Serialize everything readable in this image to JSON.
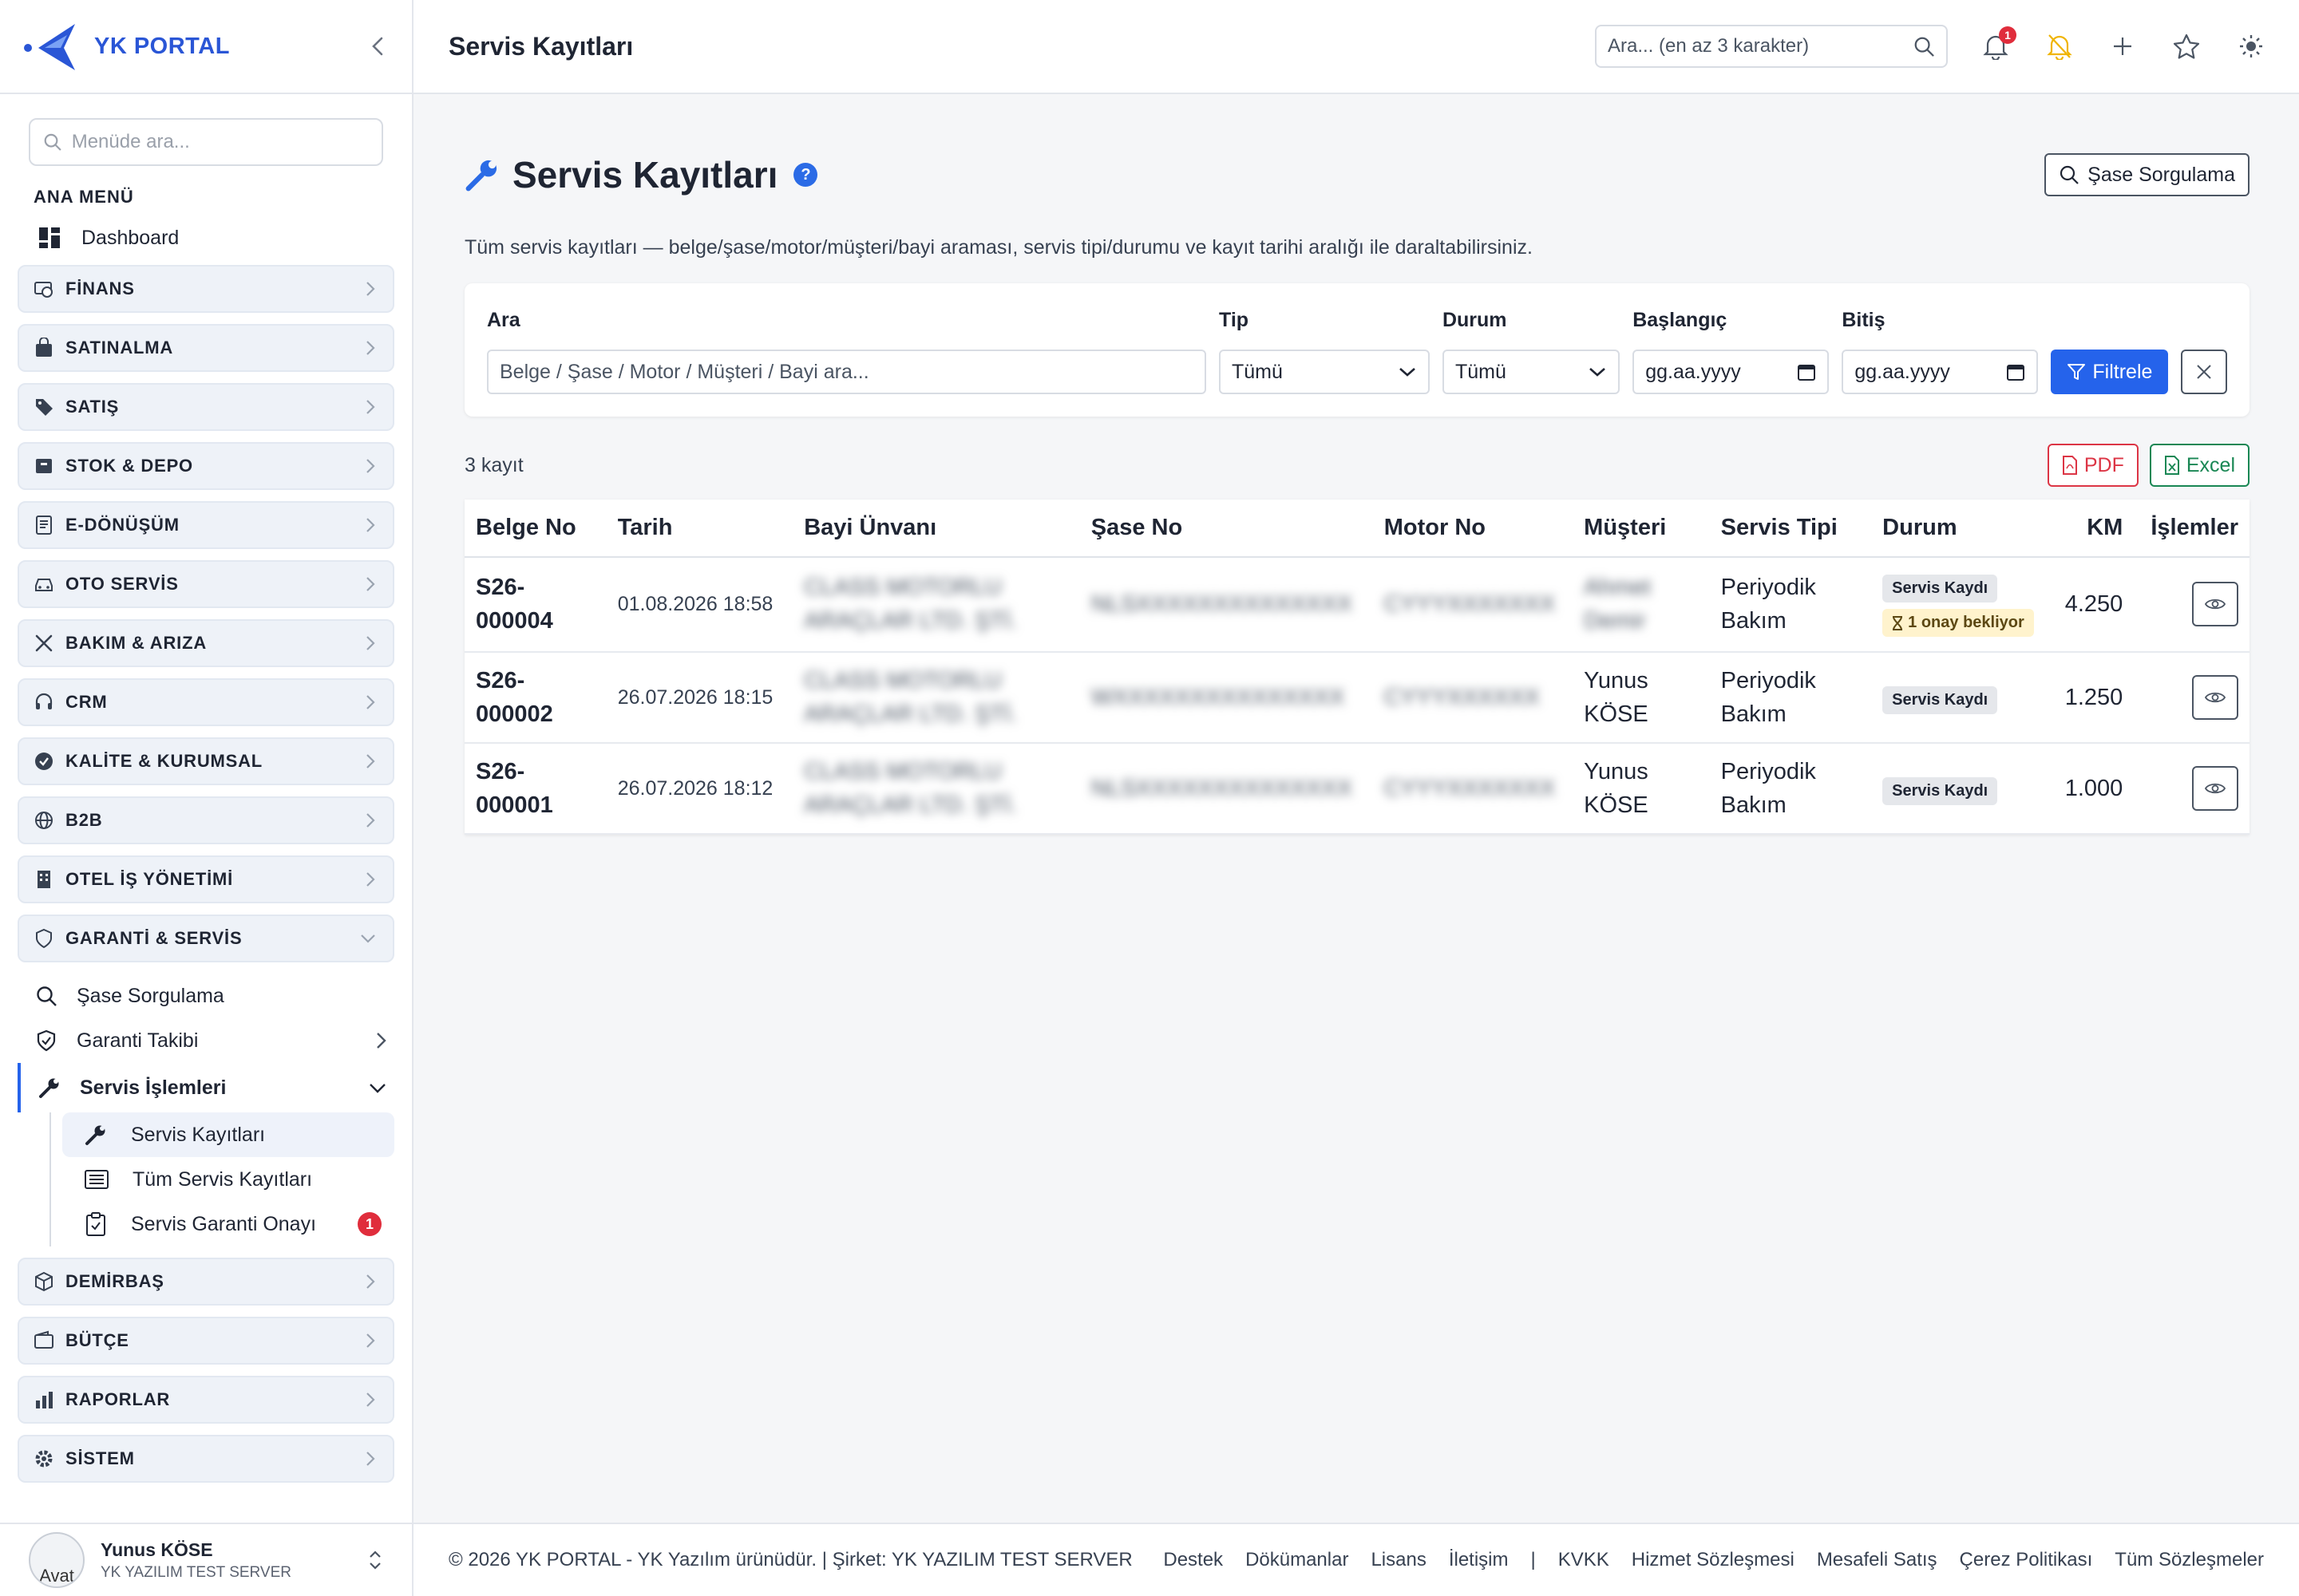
{
  "brand": {
    "name": "YK PORTAL"
  },
  "sidebar": {
    "search_placeholder": "Menüde ara...",
    "menu_title": "ANA MENÜ",
    "dashboard_label": "Dashboard",
    "groups_top": [
      {
        "label": "FİNANS",
        "icon": "finance-icon"
      },
      {
        "label": "SATINALMA",
        "icon": "shopping-bag-icon"
      },
      {
        "label": "SATIŞ",
        "icon": "tag-icon"
      },
      {
        "label": "STOK & DEPO",
        "icon": "box-icon"
      },
      {
        "label": "E-DÖNÜŞÜM",
        "icon": "document-icon"
      },
      {
        "label": "OTO SERVİS",
        "icon": "car-icon"
      },
      {
        "label": "BAKIM & ARIZA",
        "icon": "tools-icon"
      },
      {
        "label": "CRM",
        "icon": "headset-icon"
      },
      {
        "label": "KALİTE & KURUMSAL",
        "icon": "badge-check-icon"
      },
      {
        "label": "B2B",
        "icon": "globe-icon"
      },
      {
        "label": "OTEL İŞ YÖNETİMİ",
        "icon": "building-icon"
      }
    ],
    "open_group": {
      "label": "GARANTİ & SERVİS",
      "items": [
        {
          "label": "Şase Sorgulama"
        },
        {
          "label": "Garanti Takibi"
        }
      ],
      "active_parent": {
        "label": "Servis İşlemleri",
        "children": [
          {
            "label": "Servis Kayıtları"
          },
          {
            "label": "Tüm Servis Kayıtları"
          },
          {
            "label": "Servis Garanti Onayı",
            "badge": "1"
          }
        ]
      }
    },
    "groups_bottom": [
      {
        "label": "DEMİRBAŞ"
      },
      {
        "label": "BÜTÇE"
      },
      {
        "label": "RAPORLAR"
      },
      {
        "label": "SİSTEM"
      }
    ],
    "user": {
      "name": "Yunus KÖSE",
      "org": "YK YAZILIM TEST SERVER",
      "avatar_alt": "Avat"
    }
  },
  "topbar": {
    "title": "Servis Kayıtları",
    "search_placeholder": "Ara... (en az 3 karakter)",
    "notification_count": "1"
  },
  "page": {
    "title": "Servis Kayıtları",
    "help": "?",
    "chassis_btn": "Şase Sorgulama",
    "description": "Tüm servis kayıtları — belge/şase/motor/müşteri/bayi araması, servis tipi/durumu ve kayıt tarihi aralığı ile daraltabilirsiniz."
  },
  "filters": {
    "search_label": "Ara",
    "search_placeholder": "Belge / Şase / Motor / Müşteri / Bayi ara...",
    "type_label": "Tip",
    "type_value": "Tümü",
    "status_label": "Durum",
    "status_value": "Tümü",
    "start_label": "Başlangıç",
    "start_placeholder": "gg.aa.yyyy",
    "end_label": "Bitiş",
    "end_placeholder": "gg.aa.yyyy",
    "filter_btn": "Filtrele"
  },
  "list": {
    "count": "3 kayıt",
    "pdf_btn": "PDF",
    "excel_btn": "Excel",
    "columns": [
      "Belge No",
      "Tarih",
      "Bayi Ünvanı",
      "Şase No",
      "Motor No",
      "Müşteri",
      "Servis Tipi",
      "Durum",
      "KM",
      "İşlemler"
    ],
    "rows": [
      {
        "doc": "S26-000004",
        "date": "01.08.2026 18:58",
        "dealer": "CLASS MOTORLU ARAÇLAR LTD. ŞTİ.",
        "chassis": "NLSXXXXXXXXXXXXXX",
        "engine": "CYYYXXXXXXX",
        "customer": "Ahmet Demir",
        "customer_blurred": true,
        "type": "Periyodik Bakım",
        "status": "Servis Kaydı",
        "pending": "1 onay bekliyor",
        "km": "4.250"
      },
      {
        "doc": "S26-000002",
        "date": "26.07.2026 18:15",
        "dealer": "CLASS MOTORLU ARAÇLAR LTD. ŞTİ.",
        "chassis": "WXXXXXXXXXXXXXXX",
        "engine": "CYYYXXXXXX",
        "customer": "Yunus KÖSE",
        "customer_blurred": false,
        "type": "Periyodik Bakım",
        "status": "Servis Kaydı",
        "pending": "",
        "km": "1.250"
      },
      {
        "doc": "S26-000001",
        "date": "26.07.2026 18:12",
        "dealer": "CLASS MOTORLU ARAÇLAR LTD. ŞTİ.",
        "chassis": "NLSXXXXXXXXXXXXXX",
        "engine": "CYYYXXXXXXX",
        "customer": "Yunus KÖSE",
        "customer_blurred": false,
        "type": "Periyodik Bakım",
        "status": "Servis Kaydı",
        "pending": "",
        "km": "1.000"
      }
    ]
  },
  "footer": {
    "copyright": "© 2026 YK PORTAL - YK Yazılım ürünüdür. | Şirket: YK YAZILIM TEST SERVER",
    "links_left": [
      "Destek",
      "Dökümanlar",
      "Lisans",
      "İletişim"
    ],
    "separator": "|",
    "links_right": [
      "KVKK",
      "Hizmet Sözleşmesi",
      "Mesafeli Satış",
      "Çerez Politikası",
      "Tüm Sözleşmeler"
    ]
  },
  "colors": {
    "accent": "#2563eb",
    "danger": "#dc3545",
    "success": "#198754",
    "warning_bg": "#fff3cd"
  }
}
